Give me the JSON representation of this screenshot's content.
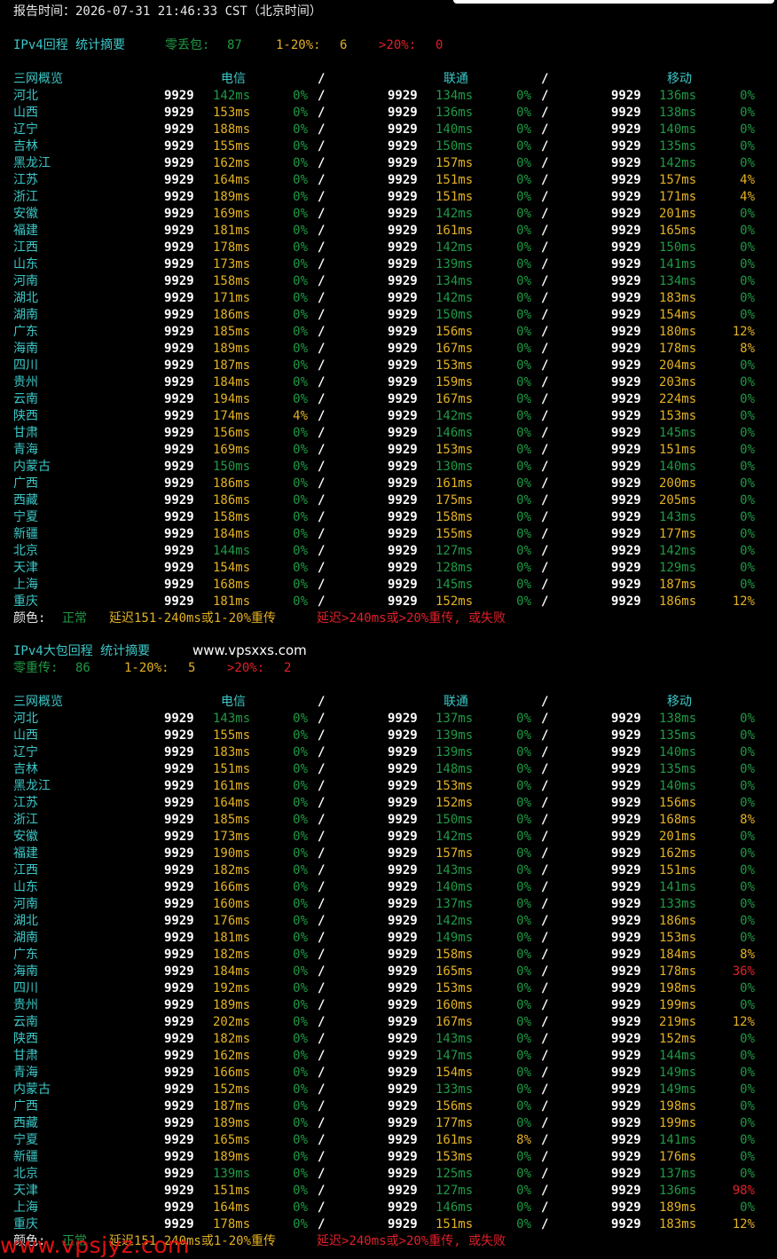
{
  "report_time": "报告时间：2026-07-31 21:46:33 CST（北京时间）",
  "colors": {
    "normal": "#1f9a45",
    "warn": "#e4b223",
    "bad": "#e0202a",
    "label": "#3cc7c7"
  },
  "sections": [
    {
      "title": "IPv4回程 统计摘要",
      "summary": {
        "zero_label": "零丢包:",
        "zero_value": "87",
        "mid_label": "1-20%:",
        "mid_value": "6",
        "high_label": ">20%:",
        "high_value": "0"
      },
      "site": "",
      "overview": "三网概览",
      "carriers": [
        "电信",
        "联通",
        "移动"
      ],
      "rows": [
        [
          "河北",
          "9929",
          "142ms",
          "0%",
          "9929",
          "134ms",
          "0%",
          "9929",
          "136ms",
          "0%"
        ],
        [
          "山西",
          "9929",
          "153ms",
          "0%",
          "9929",
          "136ms",
          "0%",
          "9929",
          "138ms",
          "0%"
        ],
        [
          "辽宁",
          "9929",
          "188ms",
          "0%",
          "9929",
          "140ms",
          "0%",
          "9929",
          "140ms",
          "0%"
        ],
        [
          "吉林",
          "9929",
          "155ms",
          "0%",
          "9929",
          "150ms",
          "0%",
          "9929",
          "135ms",
          "0%"
        ],
        [
          "黑龙江",
          "9929",
          "162ms",
          "0%",
          "9929",
          "157ms",
          "0%",
          "9929",
          "142ms",
          "0%"
        ],
        [
          "江苏",
          "9929",
          "164ms",
          "0%",
          "9929",
          "151ms",
          "0%",
          "9929",
          "157ms",
          "4%"
        ],
        [
          "浙江",
          "9929",
          "189ms",
          "0%",
          "9929",
          "151ms",
          "0%",
          "9929",
          "171ms",
          "4%"
        ],
        [
          "安徽",
          "9929",
          "169ms",
          "0%",
          "9929",
          "142ms",
          "0%",
          "9929",
          "201ms",
          "0%"
        ],
        [
          "福建",
          "9929",
          "181ms",
          "0%",
          "9929",
          "161ms",
          "0%",
          "9929",
          "165ms",
          "0%"
        ],
        [
          "江西",
          "9929",
          "178ms",
          "0%",
          "9929",
          "142ms",
          "0%",
          "9929",
          "150ms",
          "0%"
        ],
        [
          "山东",
          "9929",
          "173ms",
          "0%",
          "9929",
          "139ms",
          "0%",
          "9929",
          "141ms",
          "0%"
        ],
        [
          "河南",
          "9929",
          "158ms",
          "0%",
          "9929",
          "134ms",
          "0%",
          "9929",
          "134ms",
          "0%"
        ],
        [
          "湖北",
          "9929",
          "171ms",
          "0%",
          "9929",
          "142ms",
          "0%",
          "9929",
          "183ms",
          "0%"
        ],
        [
          "湖南",
          "9929",
          "186ms",
          "0%",
          "9929",
          "150ms",
          "0%",
          "9929",
          "154ms",
          "0%"
        ],
        [
          "广东",
          "9929",
          "185ms",
          "0%",
          "9929",
          "156ms",
          "0%",
          "9929",
          "180ms",
          "12%"
        ],
        [
          "海南",
          "9929",
          "189ms",
          "0%",
          "9929",
          "167ms",
          "0%",
          "9929",
          "178ms",
          "8%"
        ],
        [
          "四川",
          "9929",
          "187ms",
          "0%",
          "9929",
          "153ms",
          "0%",
          "9929",
          "204ms",
          "0%"
        ],
        [
          "贵州",
          "9929",
          "184ms",
          "0%",
          "9929",
          "159ms",
          "0%",
          "9929",
          "203ms",
          "0%"
        ],
        [
          "云南",
          "9929",
          "194ms",
          "0%",
          "9929",
          "167ms",
          "0%",
          "9929",
          "224ms",
          "0%"
        ],
        [
          "陕西",
          "9929",
          "174ms",
          "4%",
          "9929",
          "142ms",
          "0%",
          "9929",
          "153ms",
          "0%"
        ],
        [
          "甘肃",
          "9929",
          "156ms",
          "0%",
          "9929",
          "146ms",
          "0%",
          "9929",
          "145ms",
          "0%"
        ],
        [
          "青海",
          "9929",
          "169ms",
          "0%",
          "9929",
          "153ms",
          "0%",
          "9929",
          "151ms",
          "0%"
        ],
        [
          "内蒙古",
          "9929",
          "150ms",
          "0%",
          "9929",
          "130ms",
          "0%",
          "9929",
          "140ms",
          "0%"
        ],
        [
          "广西",
          "9929",
          "186ms",
          "0%",
          "9929",
          "161ms",
          "0%",
          "9929",
          "200ms",
          "0%"
        ],
        [
          "西藏",
          "9929",
          "186ms",
          "0%",
          "9929",
          "175ms",
          "0%",
          "9929",
          "205ms",
          "0%"
        ],
        [
          "宁夏",
          "9929",
          "158ms",
          "0%",
          "9929",
          "158ms",
          "0%",
          "9929",
          "143ms",
          "0%"
        ],
        [
          "新疆",
          "9929",
          "184ms",
          "0%",
          "9929",
          "155ms",
          "0%",
          "9929",
          "177ms",
          "0%"
        ],
        [
          "北京",
          "9929",
          "144ms",
          "0%",
          "9929",
          "127ms",
          "0%",
          "9929",
          "142ms",
          "0%"
        ],
        [
          "天津",
          "9929",
          "154ms",
          "0%",
          "9929",
          "128ms",
          "0%",
          "9929",
          "129ms",
          "0%"
        ],
        [
          "上海",
          "9929",
          "168ms",
          "0%",
          "9929",
          "145ms",
          "0%",
          "9929",
          "187ms",
          "0%"
        ],
        [
          "重庆",
          "9929",
          "181ms",
          "0%",
          "9929",
          "152ms",
          "0%",
          "9929",
          "186ms",
          "12%"
        ]
      ],
      "legend": {
        "prefix": "颜色:",
        "normal": "正常",
        "warn": "延迟151-240ms或1-20%重传",
        "bad": "延迟>240ms或>20%重传, 或失败"
      }
    },
    {
      "title": "IPv4大包回程 统计摘要",
      "summary": {
        "zero_label": "零重传:",
        "zero_value": "86",
        "mid_label": "1-20%:",
        "mid_value": "5",
        "high_label": ">20%:",
        "high_value": "2"
      },
      "site": "www.vpsxxs.com",
      "overview": "三网概览",
      "carriers": [
        "电信",
        "联通",
        "移动"
      ],
      "rows": [
        [
          "河北",
          "9929",
          "143ms",
          "0%",
          "9929",
          "137ms",
          "0%",
          "9929",
          "138ms",
          "0%"
        ],
        [
          "山西",
          "9929",
          "155ms",
          "0%",
          "9929",
          "139ms",
          "0%",
          "9929",
          "135ms",
          "0%"
        ],
        [
          "辽宁",
          "9929",
          "183ms",
          "0%",
          "9929",
          "139ms",
          "0%",
          "9929",
          "140ms",
          "0%"
        ],
        [
          "吉林",
          "9929",
          "151ms",
          "0%",
          "9929",
          "148ms",
          "0%",
          "9929",
          "135ms",
          "0%"
        ],
        [
          "黑龙江",
          "9929",
          "161ms",
          "0%",
          "9929",
          "153ms",
          "0%",
          "9929",
          "140ms",
          "0%"
        ],
        [
          "江苏",
          "9929",
          "164ms",
          "0%",
          "9929",
          "152ms",
          "0%",
          "9929",
          "156ms",
          "0%"
        ],
        [
          "浙江",
          "9929",
          "185ms",
          "0%",
          "9929",
          "150ms",
          "0%",
          "9929",
          "168ms",
          "8%"
        ],
        [
          "安徽",
          "9929",
          "173ms",
          "0%",
          "9929",
          "142ms",
          "0%",
          "9929",
          "201ms",
          "0%"
        ],
        [
          "福建",
          "9929",
          "190ms",
          "0%",
          "9929",
          "157ms",
          "0%",
          "9929",
          "162ms",
          "0%"
        ],
        [
          "江西",
          "9929",
          "182ms",
          "0%",
          "9929",
          "143ms",
          "0%",
          "9929",
          "151ms",
          "0%"
        ],
        [
          "山东",
          "9929",
          "166ms",
          "0%",
          "9929",
          "140ms",
          "0%",
          "9929",
          "141ms",
          "0%"
        ],
        [
          "河南",
          "9929",
          "160ms",
          "0%",
          "9929",
          "137ms",
          "0%",
          "9929",
          "133ms",
          "0%"
        ],
        [
          "湖北",
          "9929",
          "176ms",
          "0%",
          "9929",
          "142ms",
          "0%",
          "9929",
          "186ms",
          "0%"
        ],
        [
          "湖南",
          "9929",
          "181ms",
          "0%",
          "9929",
          "149ms",
          "0%",
          "9929",
          "153ms",
          "0%"
        ],
        [
          "广东",
          "9929",
          "182ms",
          "0%",
          "9929",
          "158ms",
          "0%",
          "9929",
          "184ms",
          "8%"
        ],
        [
          "海南",
          "9929",
          "184ms",
          "0%",
          "9929",
          "165ms",
          "0%",
          "9929",
          "178ms",
          "36%"
        ],
        [
          "四川",
          "9929",
          "192ms",
          "0%",
          "9929",
          "153ms",
          "0%",
          "9929",
          "198ms",
          "0%"
        ],
        [
          "贵州",
          "9929",
          "189ms",
          "0%",
          "9929",
          "160ms",
          "0%",
          "9929",
          "199ms",
          "0%"
        ],
        [
          "云南",
          "9929",
          "202ms",
          "0%",
          "9929",
          "167ms",
          "0%",
          "9929",
          "219ms",
          "12%"
        ],
        [
          "陕西",
          "9929",
          "182ms",
          "0%",
          "9929",
          "143ms",
          "0%",
          "9929",
          "152ms",
          "0%"
        ],
        [
          "甘肃",
          "9929",
          "162ms",
          "0%",
          "9929",
          "147ms",
          "0%",
          "9929",
          "144ms",
          "0%"
        ],
        [
          "青海",
          "9929",
          "166ms",
          "0%",
          "9929",
          "154ms",
          "0%",
          "9929",
          "149ms",
          "0%"
        ],
        [
          "内蒙古",
          "9929",
          "152ms",
          "0%",
          "9929",
          "133ms",
          "0%",
          "9929",
          "149ms",
          "0%"
        ],
        [
          "广西",
          "9929",
          "187ms",
          "0%",
          "9929",
          "156ms",
          "0%",
          "9929",
          "198ms",
          "0%"
        ],
        [
          "西藏",
          "9929",
          "189ms",
          "0%",
          "9929",
          "177ms",
          "0%",
          "9929",
          "199ms",
          "0%"
        ],
        [
          "宁夏",
          "9929",
          "165ms",
          "0%",
          "9929",
          "161ms",
          "8%",
          "9929",
          "141ms",
          "0%"
        ],
        [
          "新疆",
          "9929",
          "189ms",
          "0%",
          "9929",
          "153ms",
          "0%",
          "9929",
          "176ms",
          "0%"
        ],
        [
          "北京",
          "9929",
          "139ms",
          "0%",
          "9929",
          "125ms",
          "0%",
          "9929",
          "137ms",
          "0%"
        ],
        [
          "天津",
          "9929",
          "151ms",
          "0%",
          "9929",
          "127ms",
          "0%",
          "9929",
          "136ms",
          "98%"
        ],
        [
          "上海",
          "9929",
          "164ms",
          "0%",
          "9929",
          "146ms",
          "0%",
          "9929",
          "189ms",
          "0%"
        ],
        [
          "重庆",
          "9929",
          "178ms",
          "0%",
          "9929",
          "151ms",
          "0%",
          "9929",
          "183ms",
          "12%"
        ]
      ],
      "legend": {
        "prefix": "颜色:",
        "normal": "正常",
        "warn": "延迟151-240ms或1-20%重传",
        "bad": "延迟>240ms或>20%重传, 或失败"
      }
    }
  ],
  "watermark": "www.vpsjyz.com"
}
